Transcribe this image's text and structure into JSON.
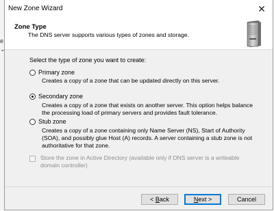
{
  "behind_window": {
    "marks": [
      "e",
      "⌄"
    ]
  },
  "window": {
    "title": "New Zone Wizard",
    "close_glyph": "✕"
  },
  "header": {
    "title": "Zone Type",
    "subtitle": "The DNS server supports various types of zones and storage.",
    "icon": "server-icon"
  },
  "body": {
    "prompt": "Select the type of zone you want to create:",
    "options": [
      {
        "label": "Primary zone",
        "checked": false,
        "description": "Creates a copy of a zone that can be updated directly on this server."
      },
      {
        "label": "Secondary zone",
        "checked": true,
        "description": "Creates a copy of a zone that exists on another server. This option helps balance the processing load of primary servers and provides fault tolerance."
      },
      {
        "label": "Stub zone",
        "checked": false,
        "description": "Creates a copy of a zone containing only Name Server (NS), Start of Authority (SOA), and possibly glue Host (A) records. A server containing a stub zone is not authoritative for that zone."
      }
    ],
    "store_checkbox": {
      "label": "Store the zone in Active Directory (available only if DNS server is a writeable domain controller)",
      "checked": false,
      "disabled": true
    }
  },
  "footer": {
    "back_prefix": "< ",
    "back_key": "B",
    "back_rest": "ack",
    "next_key": "N",
    "next_rest": "ext >",
    "cancel_label": "Cancel"
  }
}
